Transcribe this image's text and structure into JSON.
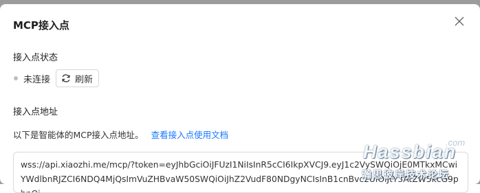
{
  "dialog": {
    "title": "MCP接入点",
    "close_icon": "close-icon"
  },
  "status_section": {
    "label": "接入点状态",
    "status_text": "未连接",
    "status_color": "#bdbdbd",
    "refresh_label": "刷新",
    "refresh_icon": "refresh-icon"
  },
  "address_section": {
    "label": "接入点地址",
    "description": "以下是智能体的MCP接入点地址。",
    "doc_link": "查看接入点使用文档",
    "link_color": "#1677ff",
    "url": "wss://api.xiaozhi.me/mcp/?token=eyJhbGciOiJFUzI1NiIsInR5cCI6IkpXVCJ9.eyJ1c2VySWQiOjE0MTkxMCwiYWdlbnRJZCI6NDQ4MjQsImVuZHBvaW50SWQiOiJhZ2VudF80NDgyNCIsInB1cnBvc2UiOiJtY3AtZW5kcG9pbnQi"
  },
  "watermark": {
    "domain_suffix": ".com",
    "brand": "Hassbian",
    "subtitle": "瀚思彼岸技术论坛"
  }
}
